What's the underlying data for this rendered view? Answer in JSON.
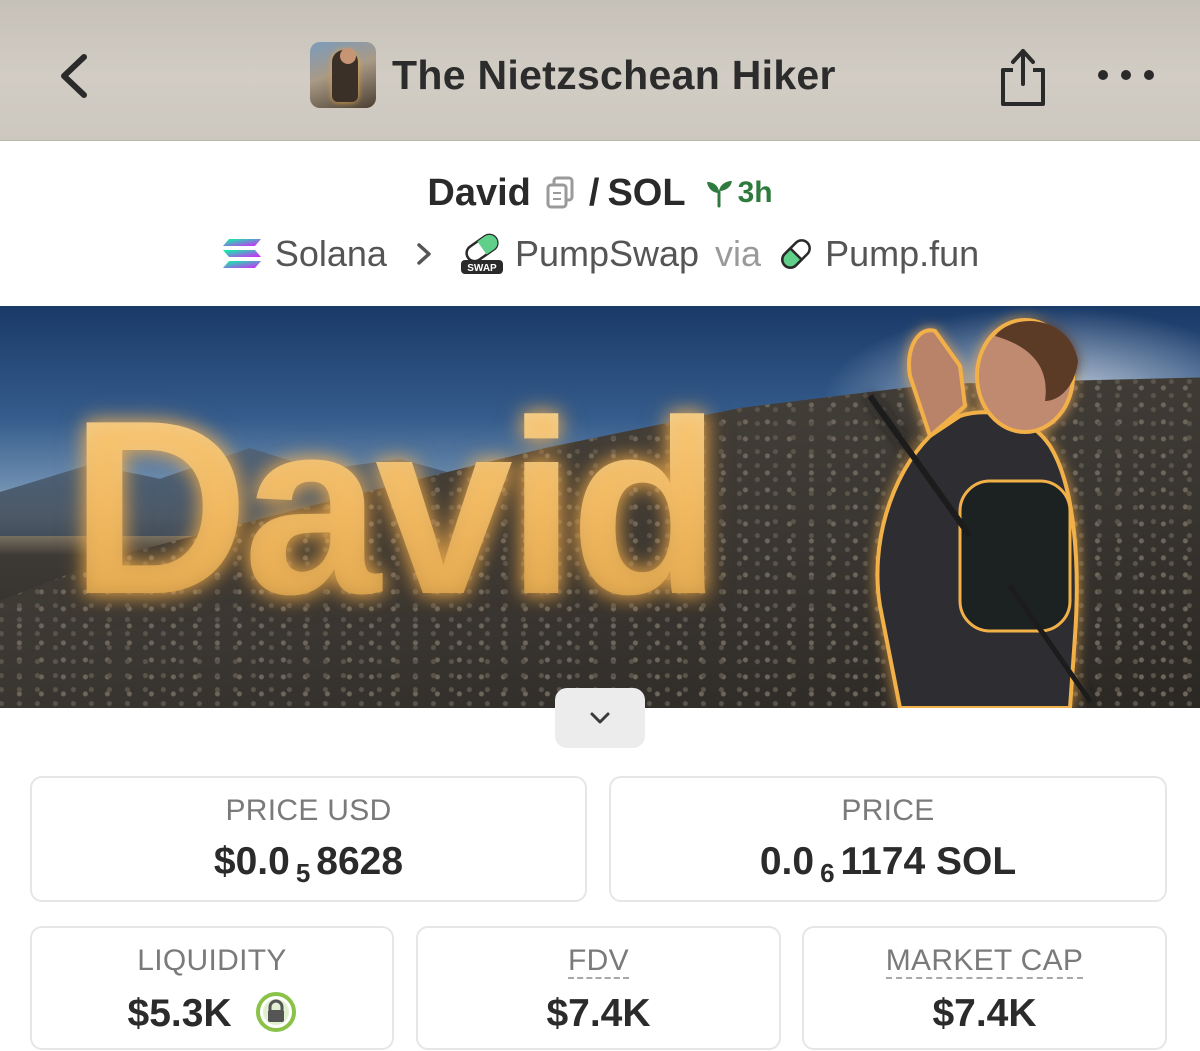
{
  "header": {
    "title": "The Nietzschean Hiker",
    "back_icon": "chevron-left-icon",
    "share_icon": "share-icon",
    "more_icon": "more-horizontal-icon"
  },
  "pair": {
    "base": "David",
    "separator": "/",
    "quote": "SOL",
    "age": "3h"
  },
  "chain": {
    "network": "Solana",
    "dex": "PumpSwap",
    "via_label": "via",
    "launchpad": "Pump.fun"
  },
  "banner": {
    "word": "David"
  },
  "stats": {
    "price_usd": {
      "label": "PRICE USD",
      "prefix": "$0.0",
      "zeros": "5",
      "digits": "8628"
    },
    "price_native": {
      "label": "PRICE",
      "prefix": "0.0",
      "zeros": "6",
      "digits": "1174 SOL"
    },
    "liquidity": {
      "label": "LIQUIDITY",
      "value": "$5.3K"
    },
    "fdv": {
      "label": "FDV",
      "value": "$7.4K"
    },
    "market_cap": {
      "label": "MARKET CAP",
      "value": "$7.4K"
    }
  },
  "colors": {
    "age_green": "#2f7b3d",
    "lock_green": "#8bc34a",
    "banner_gold": "#e3b469"
  }
}
